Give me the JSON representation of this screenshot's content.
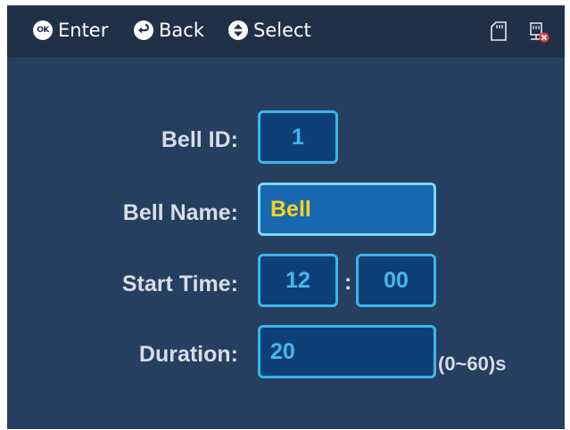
{
  "header": {
    "hints": [
      {
        "icon": "ok-icon",
        "badge": "OK",
        "label": "Enter"
      },
      {
        "icon": "back-arrow-icon",
        "label": "Back"
      },
      {
        "icon": "up-down-icon",
        "label": "Select"
      }
    ],
    "status_icons": [
      "sd-card-icon",
      "network-disconnected-icon"
    ]
  },
  "form": {
    "bell_id": {
      "label": "Bell ID:",
      "value": "1"
    },
    "bell_name": {
      "label": "Bell Name:",
      "value": "Bell"
    },
    "start_time": {
      "label": "Start Time:",
      "hour": "12",
      "separator": ":",
      "minute": "00"
    },
    "duration": {
      "label": "Duration:",
      "value": "20",
      "unit": "(0~60)s"
    }
  },
  "colors": {
    "screen_bg": "#263e5f",
    "topbar_bg": "#1f3047",
    "field_bg": "#0e4078",
    "field_border": "#3ab6ea",
    "field_text": "#47b6ec",
    "active_field_bg": "#1768b0",
    "active_field_text": "#ffd21c",
    "label_text": "#d8dde4"
  }
}
